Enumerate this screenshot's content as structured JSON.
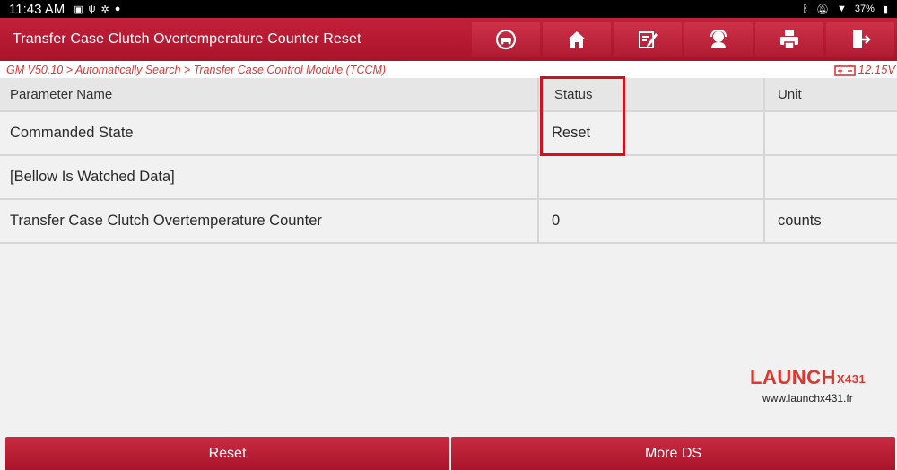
{
  "status_bar": {
    "time": "11:43 AM",
    "battery": "37%",
    "icons": [
      "gallery-icon",
      "usb-icon",
      "settings-icon",
      "message-icon",
      "bluetooth-icon",
      "mute-icon",
      "wifi-icon",
      "battery-icon"
    ]
  },
  "header": {
    "title": "Transfer Case Clutch Overtemperature Counter Reset",
    "buttons": [
      "diagnose-icon",
      "home-icon",
      "report-icon",
      "support-icon",
      "print-icon",
      "exit-icon"
    ]
  },
  "breadcrumb": {
    "path": "GM V50.10 > Automatically Search > Transfer Case Control Module (TCCM)",
    "voltage": "12.15V"
  },
  "table": {
    "columns": [
      "Parameter Name",
      "Status",
      "Unit"
    ],
    "rows": [
      [
        "Commanded State",
        "Reset",
        ""
      ],
      [
        "[Bellow Is Watched Data]",
        "",
        ""
      ],
      [
        "Transfer Case Clutch Overtemperature Counter",
        "0",
        "counts"
      ]
    ]
  },
  "watermark": {
    "brand": "LAUNCH",
    "model": "X431",
    "url": "www.launchx431.fr"
  },
  "actions": {
    "reset_label": "Reset",
    "more_label": "More DS"
  },
  "colors": {
    "accent": "#b81a30",
    "highlight": "#d2101e",
    "breadcrumb": "#d9393a"
  }
}
